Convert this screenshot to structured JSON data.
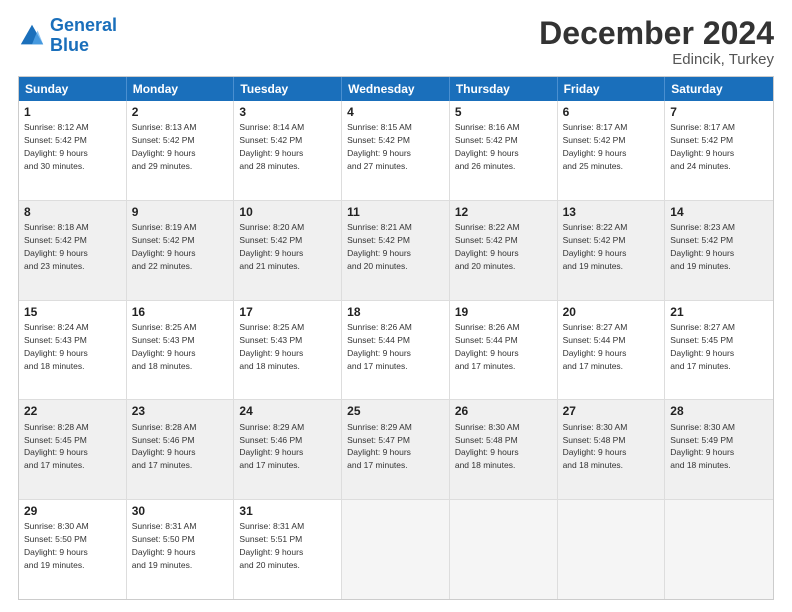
{
  "logo": {
    "line1": "General",
    "line2": "Blue"
  },
  "title": "December 2024",
  "subtitle": "Edincik, Turkey",
  "header_days": [
    "Sunday",
    "Monday",
    "Tuesday",
    "Wednesday",
    "Thursday",
    "Friday",
    "Saturday"
  ],
  "weeks": [
    [
      {
        "day": "1",
        "rise": "8:12 AM",
        "set": "5:42 PM",
        "hours": "9",
        "mins": "30",
        "shaded": false
      },
      {
        "day": "2",
        "rise": "8:13 AM",
        "set": "5:42 PM",
        "hours": "9",
        "mins": "29",
        "shaded": false
      },
      {
        "day": "3",
        "rise": "8:14 AM",
        "set": "5:42 PM",
        "hours": "9",
        "mins": "28",
        "shaded": false
      },
      {
        "day": "4",
        "rise": "8:15 AM",
        "set": "5:42 PM",
        "hours": "9",
        "mins": "27",
        "shaded": false
      },
      {
        "day": "5",
        "rise": "8:16 AM",
        "set": "5:42 PM",
        "hours": "9",
        "mins": "26",
        "shaded": false
      },
      {
        "day": "6",
        "rise": "8:17 AM",
        "set": "5:42 PM",
        "hours": "9",
        "mins": "25",
        "shaded": false
      },
      {
        "day": "7",
        "rise": "8:17 AM",
        "set": "5:42 PM",
        "hours": "9",
        "mins": "24",
        "shaded": false
      }
    ],
    [
      {
        "day": "8",
        "rise": "8:18 AM",
        "set": "5:42 PM",
        "hours": "9",
        "mins": "23",
        "shaded": true
      },
      {
        "day": "9",
        "rise": "8:19 AM",
        "set": "5:42 PM",
        "hours": "9",
        "mins": "22",
        "shaded": true
      },
      {
        "day": "10",
        "rise": "8:20 AM",
        "set": "5:42 PM",
        "hours": "9",
        "mins": "21",
        "shaded": true
      },
      {
        "day": "11",
        "rise": "8:21 AM",
        "set": "5:42 PM",
        "hours": "9",
        "mins": "20",
        "shaded": true
      },
      {
        "day": "12",
        "rise": "8:22 AM",
        "set": "5:42 PM",
        "hours": "9",
        "mins": "20",
        "shaded": true
      },
      {
        "day": "13",
        "rise": "8:22 AM",
        "set": "5:42 PM",
        "hours": "9",
        "mins": "19",
        "shaded": true
      },
      {
        "day": "14",
        "rise": "8:23 AM",
        "set": "5:42 PM",
        "hours": "9",
        "mins": "19",
        "shaded": true
      }
    ],
    [
      {
        "day": "15",
        "rise": "8:24 AM",
        "set": "5:43 PM",
        "hours": "9",
        "mins": "18",
        "shaded": false
      },
      {
        "day": "16",
        "rise": "8:25 AM",
        "set": "5:43 PM",
        "hours": "9",
        "mins": "18",
        "shaded": false
      },
      {
        "day": "17",
        "rise": "8:25 AM",
        "set": "5:43 PM",
        "hours": "9",
        "mins": "18",
        "shaded": false
      },
      {
        "day": "18",
        "rise": "8:26 AM",
        "set": "5:44 PM",
        "hours": "9",
        "mins": "17",
        "shaded": false
      },
      {
        "day": "19",
        "rise": "8:26 AM",
        "set": "5:44 PM",
        "hours": "9",
        "mins": "17",
        "shaded": false
      },
      {
        "day": "20",
        "rise": "8:27 AM",
        "set": "5:44 PM",
        "hours": "9",
        "mins": "17",
        "shaded": false
      },
      {
        "day": "21",
        "rise": "8:27 AM",
        "set": "5:45 PM",
        "hours": "9",
        "mins": "17",
        "shaded": false
      }
    ],
    [
      {
        "day": "22",
        "rise": "8:28 AM",
        "set": "5:45 PM",
        "hours": "9",
        "mins": "17",
        "shaded": true
      },
      {
        "day": "23",
        "rise": "8:28 AM",
        "set": "5:46 PM",
        "hours": "9",
        "mins": "17",
        "shaded": true
      },
      {
        "day": "24",
        "rise": "8:29 AM",
        "set": "5:46 PM",
        "hours": "9",
        "mins": "17",
        "shaded": true
      },
      {
        "day": "25",
        "rise": "8:29 AM",
        "set": "5:47 PM",
        "hours": "9",
        "mins": "17",
        "shaded": true
      },
      {
        "day": "26",
        "rise": "8:30 AM",
        "set": "5:48 PM",
        "hours": "9",
        "mins": "18",
        "shaded": true
      },
      {
        "day": "27",
        "rise": "8:30 AM",
        "set": "5:48 PM",
        "hours": "9",
        "mins": "18",
        "shaded": true
      },
      {
        "day": "28",
        "rise": "8:30 AM",
        "set": "5:49 PM",
        "hours": "9",
        "mins": "18",
        "shaded": true
      }
    ],
    [
      {
        "day": "29",
        "rise": "8:30 AM",
        "set": "5:50 PM",
        "hours": "9",
        "mins": "19",
        "shaded": false
      },
      {
        "day": "30",
        "rise": "8:31 AM",
        "set": "5:50 PM",
        "hours": "9",
        "mins": "19",
        "shaded": false
      },
      {
        "day": "31",
        "rise": "8:31 AM",
        "set": "5:51 PM",
        "hours": "9",
        "mins": "20",
        "shaded": false
      },
      {
        "day": "",
        "rise": "",
        "set": "",
        "hours": "",
        "mins": "",
        "shaded": false
      },
      {
        "day": "",
        "rise": "",
        "set": "",
        "hours": "",
        "mins": "",
        "shaded": false
      },
      {
        "day": "",
        "rise": "",
        "set": "",
        "hours": "",
        "mins": "",
        "shaded": false
      },
      {
        "day": "",
        "rise": "",
        "set": "",
        "hours": "",
        "mins": "",
        "shaded": false
      }
    ]
  ]
}
